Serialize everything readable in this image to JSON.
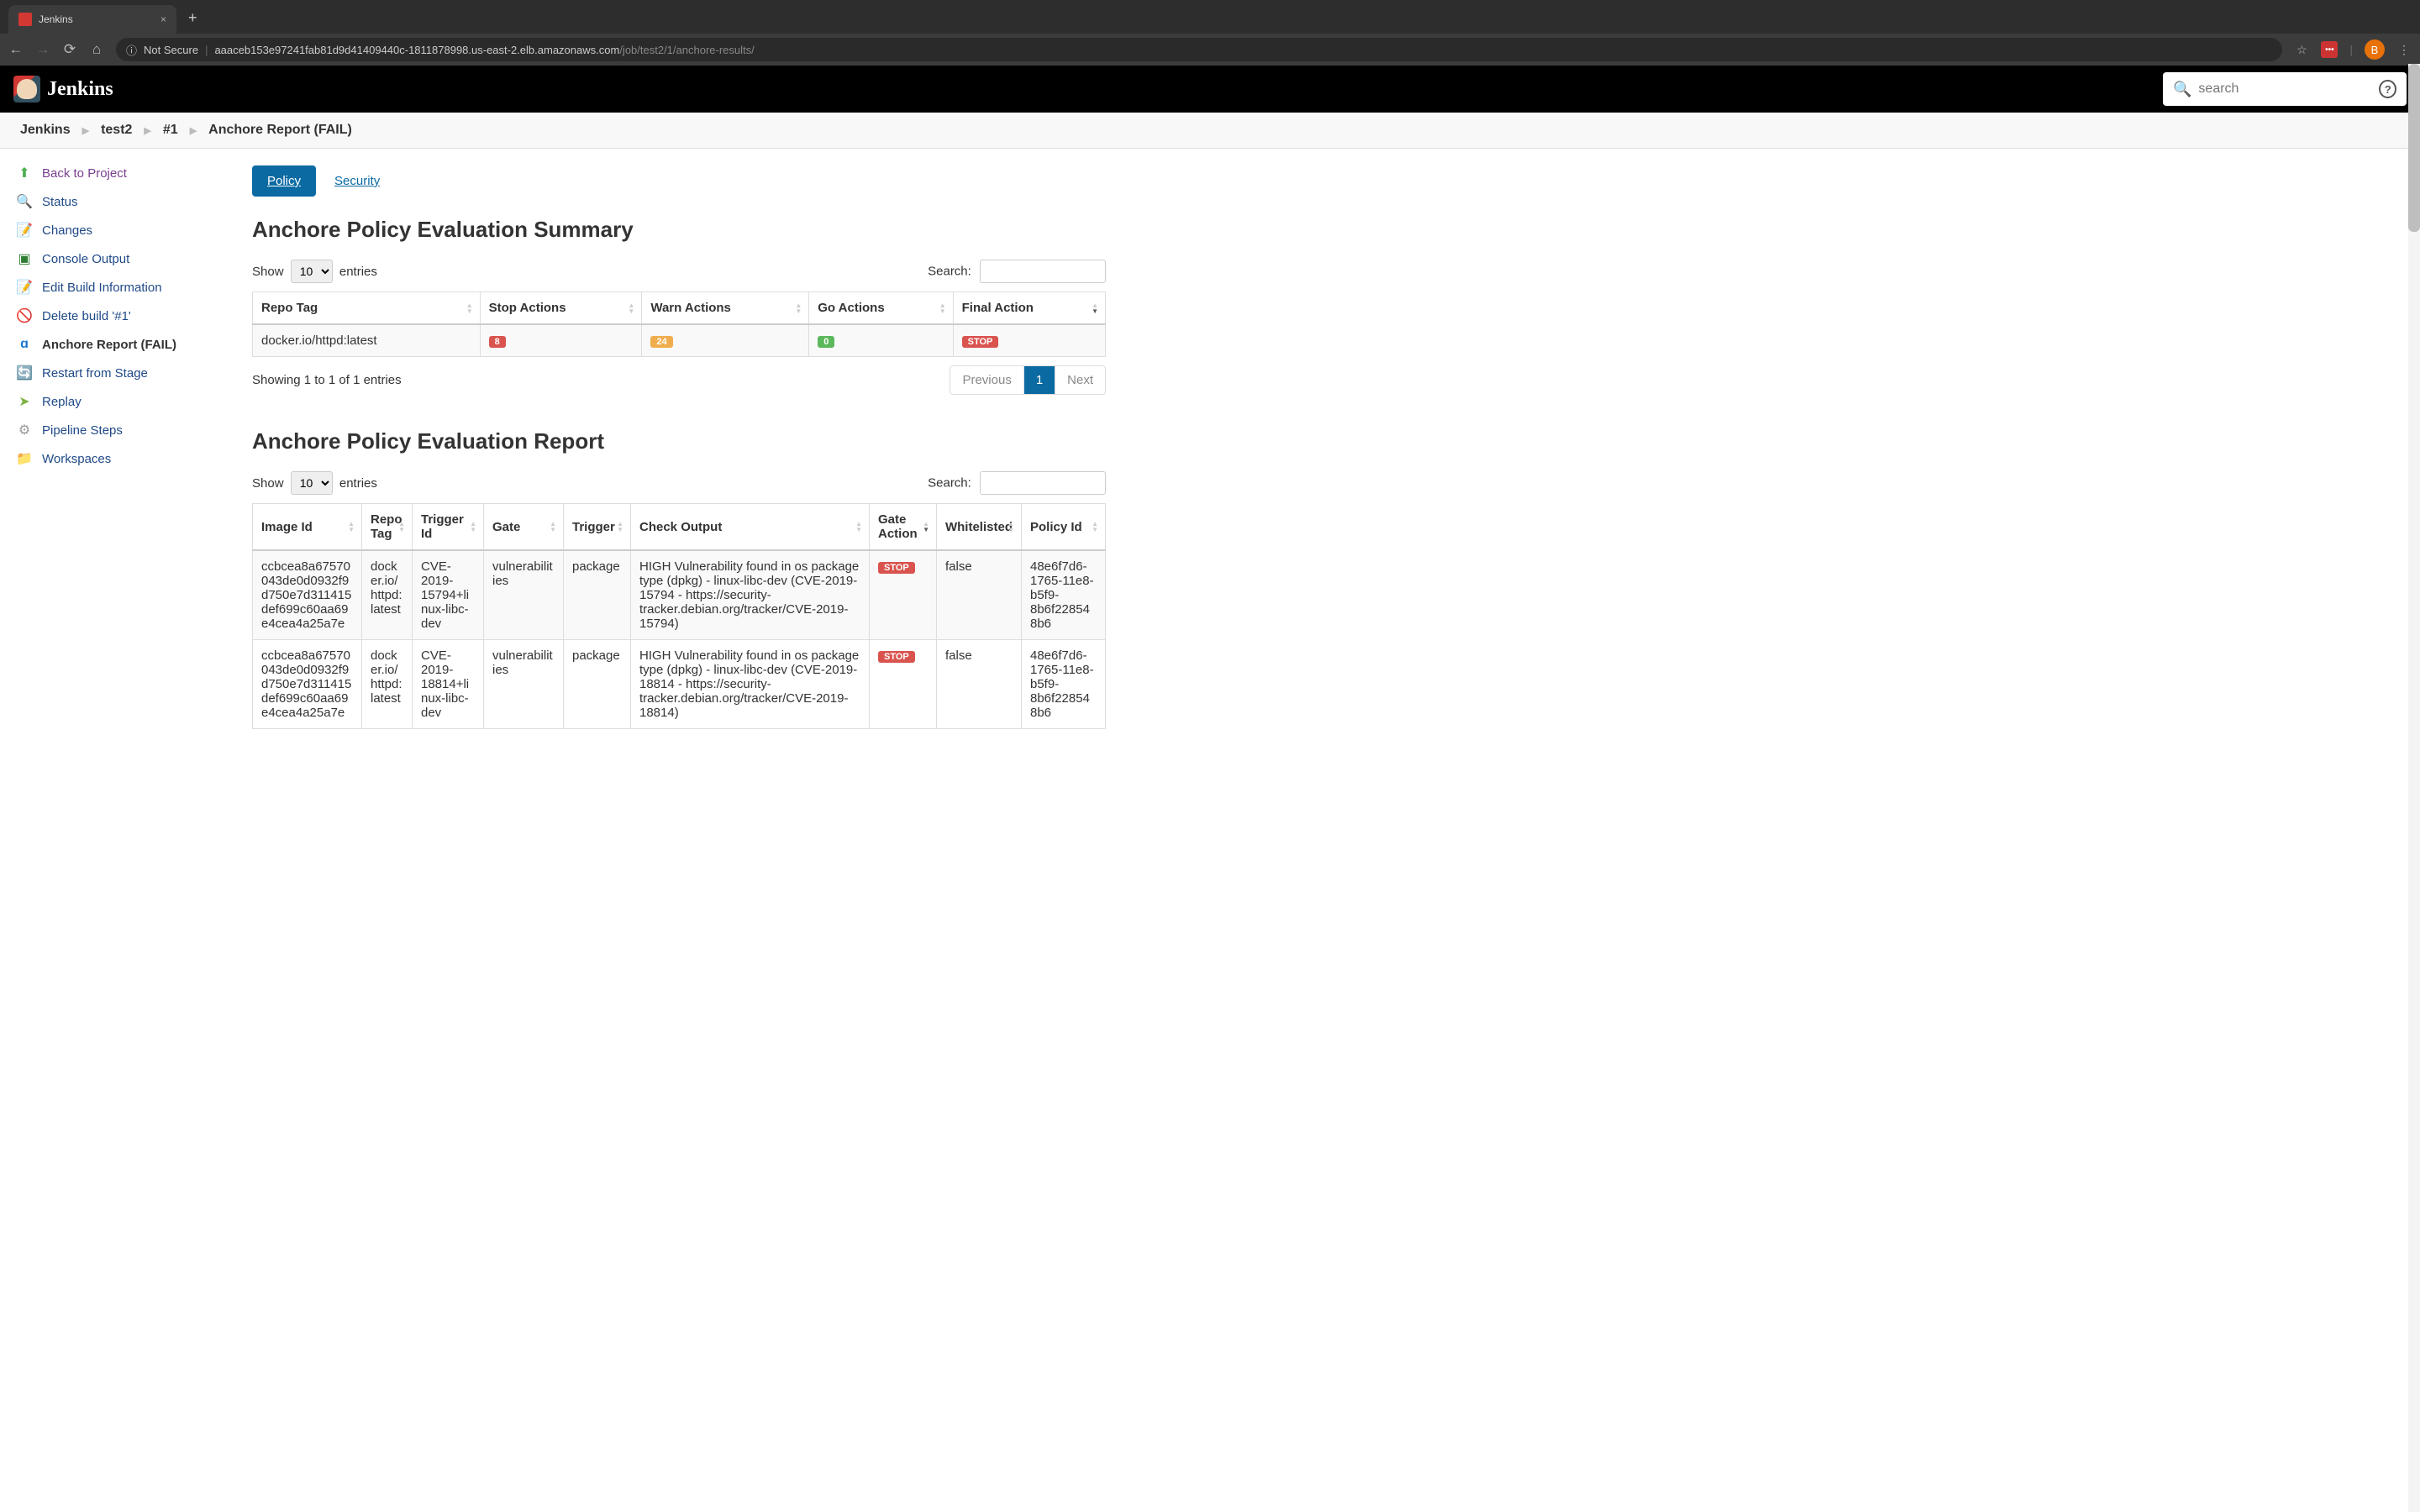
{
  "browser": {
    "tab_title": "Jenkins",
    "new_tab_glyph": "+",
    "close_glyph": "×",
    "not_secure": "Not Secure",
    "url_host": "aaaceb153e97241fab81d9d41409440c-1811878998.us-east-2.elb.amazonaws.com",
    "url_path": "/job/test2/1/anchore-results/",
    "avatar_letter": "B",
    "star": "☆",
    "menu_dots": "⋮",
    "info_glyph": "ⓘ",
    "ext_dots": "•••"
  },
  "header": {
    "brand": "Jenkins",
    "search_placeholder": "search",
    "help": "?"
  },
  "breadcrumbs": [
    "Jenkins",
    "test2",
    "#1",
    "Anchore Report (FAIL)"
  ],
  "sidebar": [
    {
      "label": "Back to Project",
      "icon": "⬆",
      "color": "#4caf50"
    },
    {
      "label": "Status",
      "icon": "🔍",
      "color": "#888"
    },
    {
      "label": "Changes",
      "icon": "📝",
      "color": "#c0a050"
    },
    {
      "label": "Console Output",
      "icon": "▣",
      "color": "#2e7d32"
    },
    {
      "label": "Edit Build Information",
      "icon": "📝",
      "color": "#c0a050"
    },
    {
      "label": "Delete build '#1'",
      "icon": "🚫",
      "color": "#d32f2f"
    },
    {
      "label": "Anchore Report (FAIL)",
      "icon": "ɑ",
      "color": "#1976d2",
      "active": true
    },
    {
      "label": "Restart from Stage",
      "icon": "🔄",
      "color": "#1976d2"
    },
    {
      "label": "Replay",
      "icon": "➤",
      "color": "#7cb342"
    },
    {
      "label": "Pipeline Steps",
      "icon": "⚙",
      "color": "#999"
    },
    {
      "label": "Workspaces",
      "icon": "📁",
      "color": "#90a4ae"
    }
  ],
  "tabs": {
    "policy": "Policy",
    "security": "Security"
  },
  "summary": {
    "title": "Anchore Policy Evaluation Summary",
    "show": "Show",
    "entries": "entries",
    "page_size": "10",
    "search": "Search:",
    "headers": [
      "Repo Tag",
      "Stop Actions",
      "Warn Actions",
      "Go Actions",
      "Final Action"
    ],
    "row": {
      "repo_tag": "docker.io/httpd:latest",
      "stop": "8",
      "warn": "24",
      "go": "0",
      "final": "STOP"
    },
    "info": "Showing 1 to 1 of 1 entries",
    "prev": "Previous",
    "page": "1",
    "next": "Next"
  },
  "report": {
    "title": "Anchore Policy Evaluation Report",
    "show": "Show",
    "entries": "entries",
    "page_size": "10",
    "search": "Search:",
    "headers": [
      "Image Id",
      "Repo Tag",
      "Trigger Id",
      "Gate",
      "Trigger",
      "Check Output",
      "Gate Action",
      "Whitelisted",
      "Policy Id"
    ],
    "rows": [
      {
        "image_id": "ccbcea8a67570043de0d0932f9d750e7d311415def699c60aa69e4cea4a25a7e",
        "repo_tag": "docker.io/httpd:latest",
        "trigger_id": "CVE-2019-15794+linux-libc-dev",
        "gate": "vulnerabilities",
        "trigger": "package",
        "check_output": "HIGH Vulnerability found in os package type (dpkg) - linux-libc-dev (CVE-2019-15794 - https://security-tracker.debian.org/tracker/CVE-2019-15794)",
        "gate_action": "STOP",
        "whitelisted": "false",
        "policy_id": "48e6f7d6-1765-11e8-b5f9-8b6f228548b6"
      },
      {
        "image_id": "ccbcea8a67570043de0d0932f9d750e7d311415def699c60aa69e4cea4a25a7e",
        "repo_tag": "docker.io/httpd:latest",
        "trigger_id": "CVE-2019-18814+linux-libc-dev",
        "gate": "vulnerabilities",
        "trigger": "package",
        "check_output": "HIGH Vulnerability found in os package type (dpkg) - linux-libc-dev (CVE-2019-18814 - https://security-tracker.debian.org/tracker/CVE-2019-18814)",
        "gate_action": "STOP",
        "whitelisted": "false",
        "policy_id": "48e6f7d6-1765-11e8-b5f9-8b6f228548b6"
      }
    ]
  }
}
